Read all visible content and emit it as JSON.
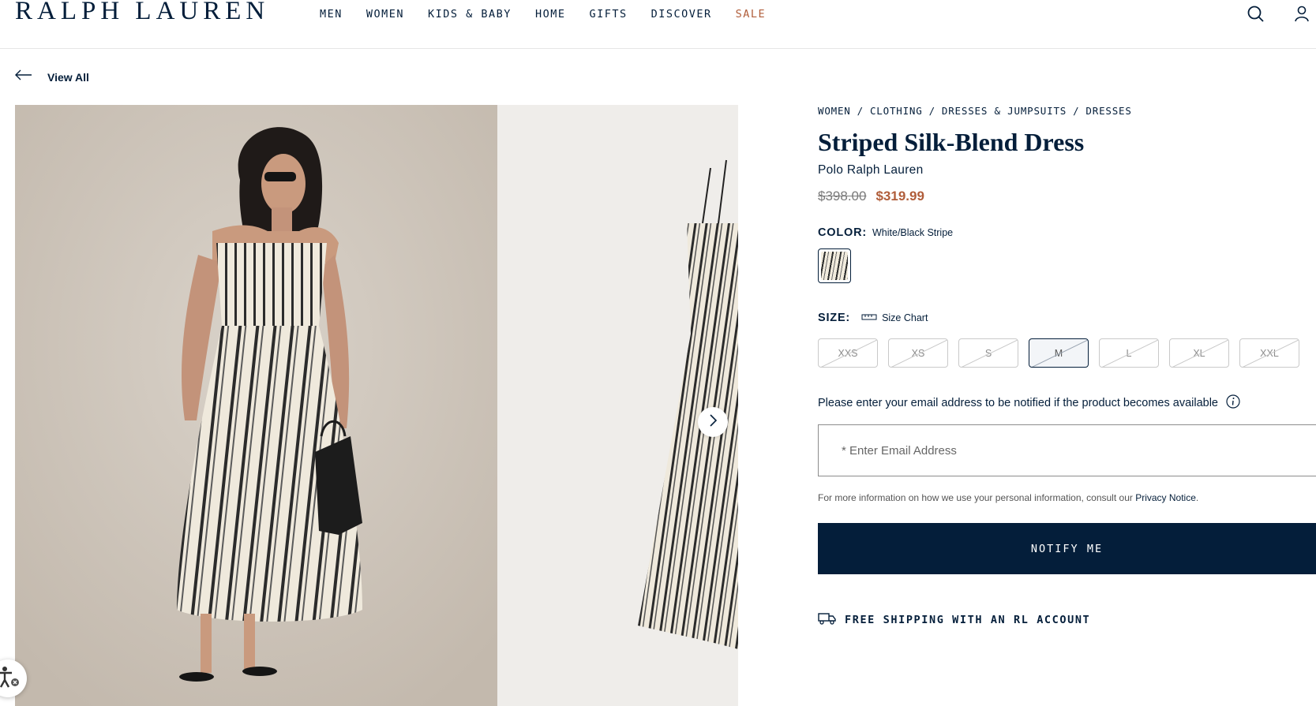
{
  "header": {
    "logo": "RALPH LAUREN",
    "nav": [
      {
        "label": "MEN"
      },
      {
        "label": "WOMEN"
      },
      {
        "label": "KIDS & BABY"
      },
      {
        "label": "HOME"
      },
      {
        "label": "GIFTS"
      },
      {
        "label": "DISCOVER"
      },
      {
        "label": "SALE",
        "accent": "#b05d3a"
      }
    ],
    "icons": [
      "search-icon",
      "account-icon"
    ]
  },
  "back_link": {
    "label": "View All",
    "icon": "arrow-left-icon"
  },
  "gallery": {
    "images": [
      "model-front-photo",
      "dress-side-photo"
    ],
    "next_icon": "chevron-right-icon"
  },
  "accessibility_icon": "accessibility-icon",
  "product": {
    "breadcrumb": [
      "WOMEN",
      "CLOTHING",
      "DRESSES & JUMPSUITS",
      "DRESSES"
    ],
    "breadcrumb_separator": "/",
    "title": "Striped Silk-Blend Dress",
    "brand": "Polo Ralph Lauren",
    "price_original": "$398.00",
    "price_sale": "$319.99",
    "color_label": "COLOR:",
    "color_value": "White/Black Stripe",
    "size_label": "SIZE:",
    "size_chart_label": "Size Chart",
    "sizes": [
      {
        "label": "XXS",
        "available": false,
        "selected": false
      },
      {
        "label": "XS",
        "available": false,
        "selected": false
      },
      {
        "label": "S",
        "available": false,
        "selected": false
      },
      {
        "label": "M",
        "available": false,
        "selected": true
      },
      {
        "label": "L",
        "available": false,
        "selected": false
      },
      {
        "label": "XL",
        "available": false,
        "selected": false
      },
      {
        "label": "XXL",
        "available": false,
        "selected": false
      }
    ],
    "notify_text": "Please enter your email address to be notified if the product becomes available",
    "email_placeholder": "* Enter Email Address",
    "privacy_text": "For more information on how we use your personal information, consult our",
    "privacy_link": "Privacy Notice",
    "privacy_end": ".",
    "notify_button": "NOTIFY ME",
    "shipping_text": "FREE SHIPPING WITH AN RL ACCOUNT"
  },
  "colors": {
    "navy": "#041e3a",
    "sale": "#b05d3a"
  }
}
